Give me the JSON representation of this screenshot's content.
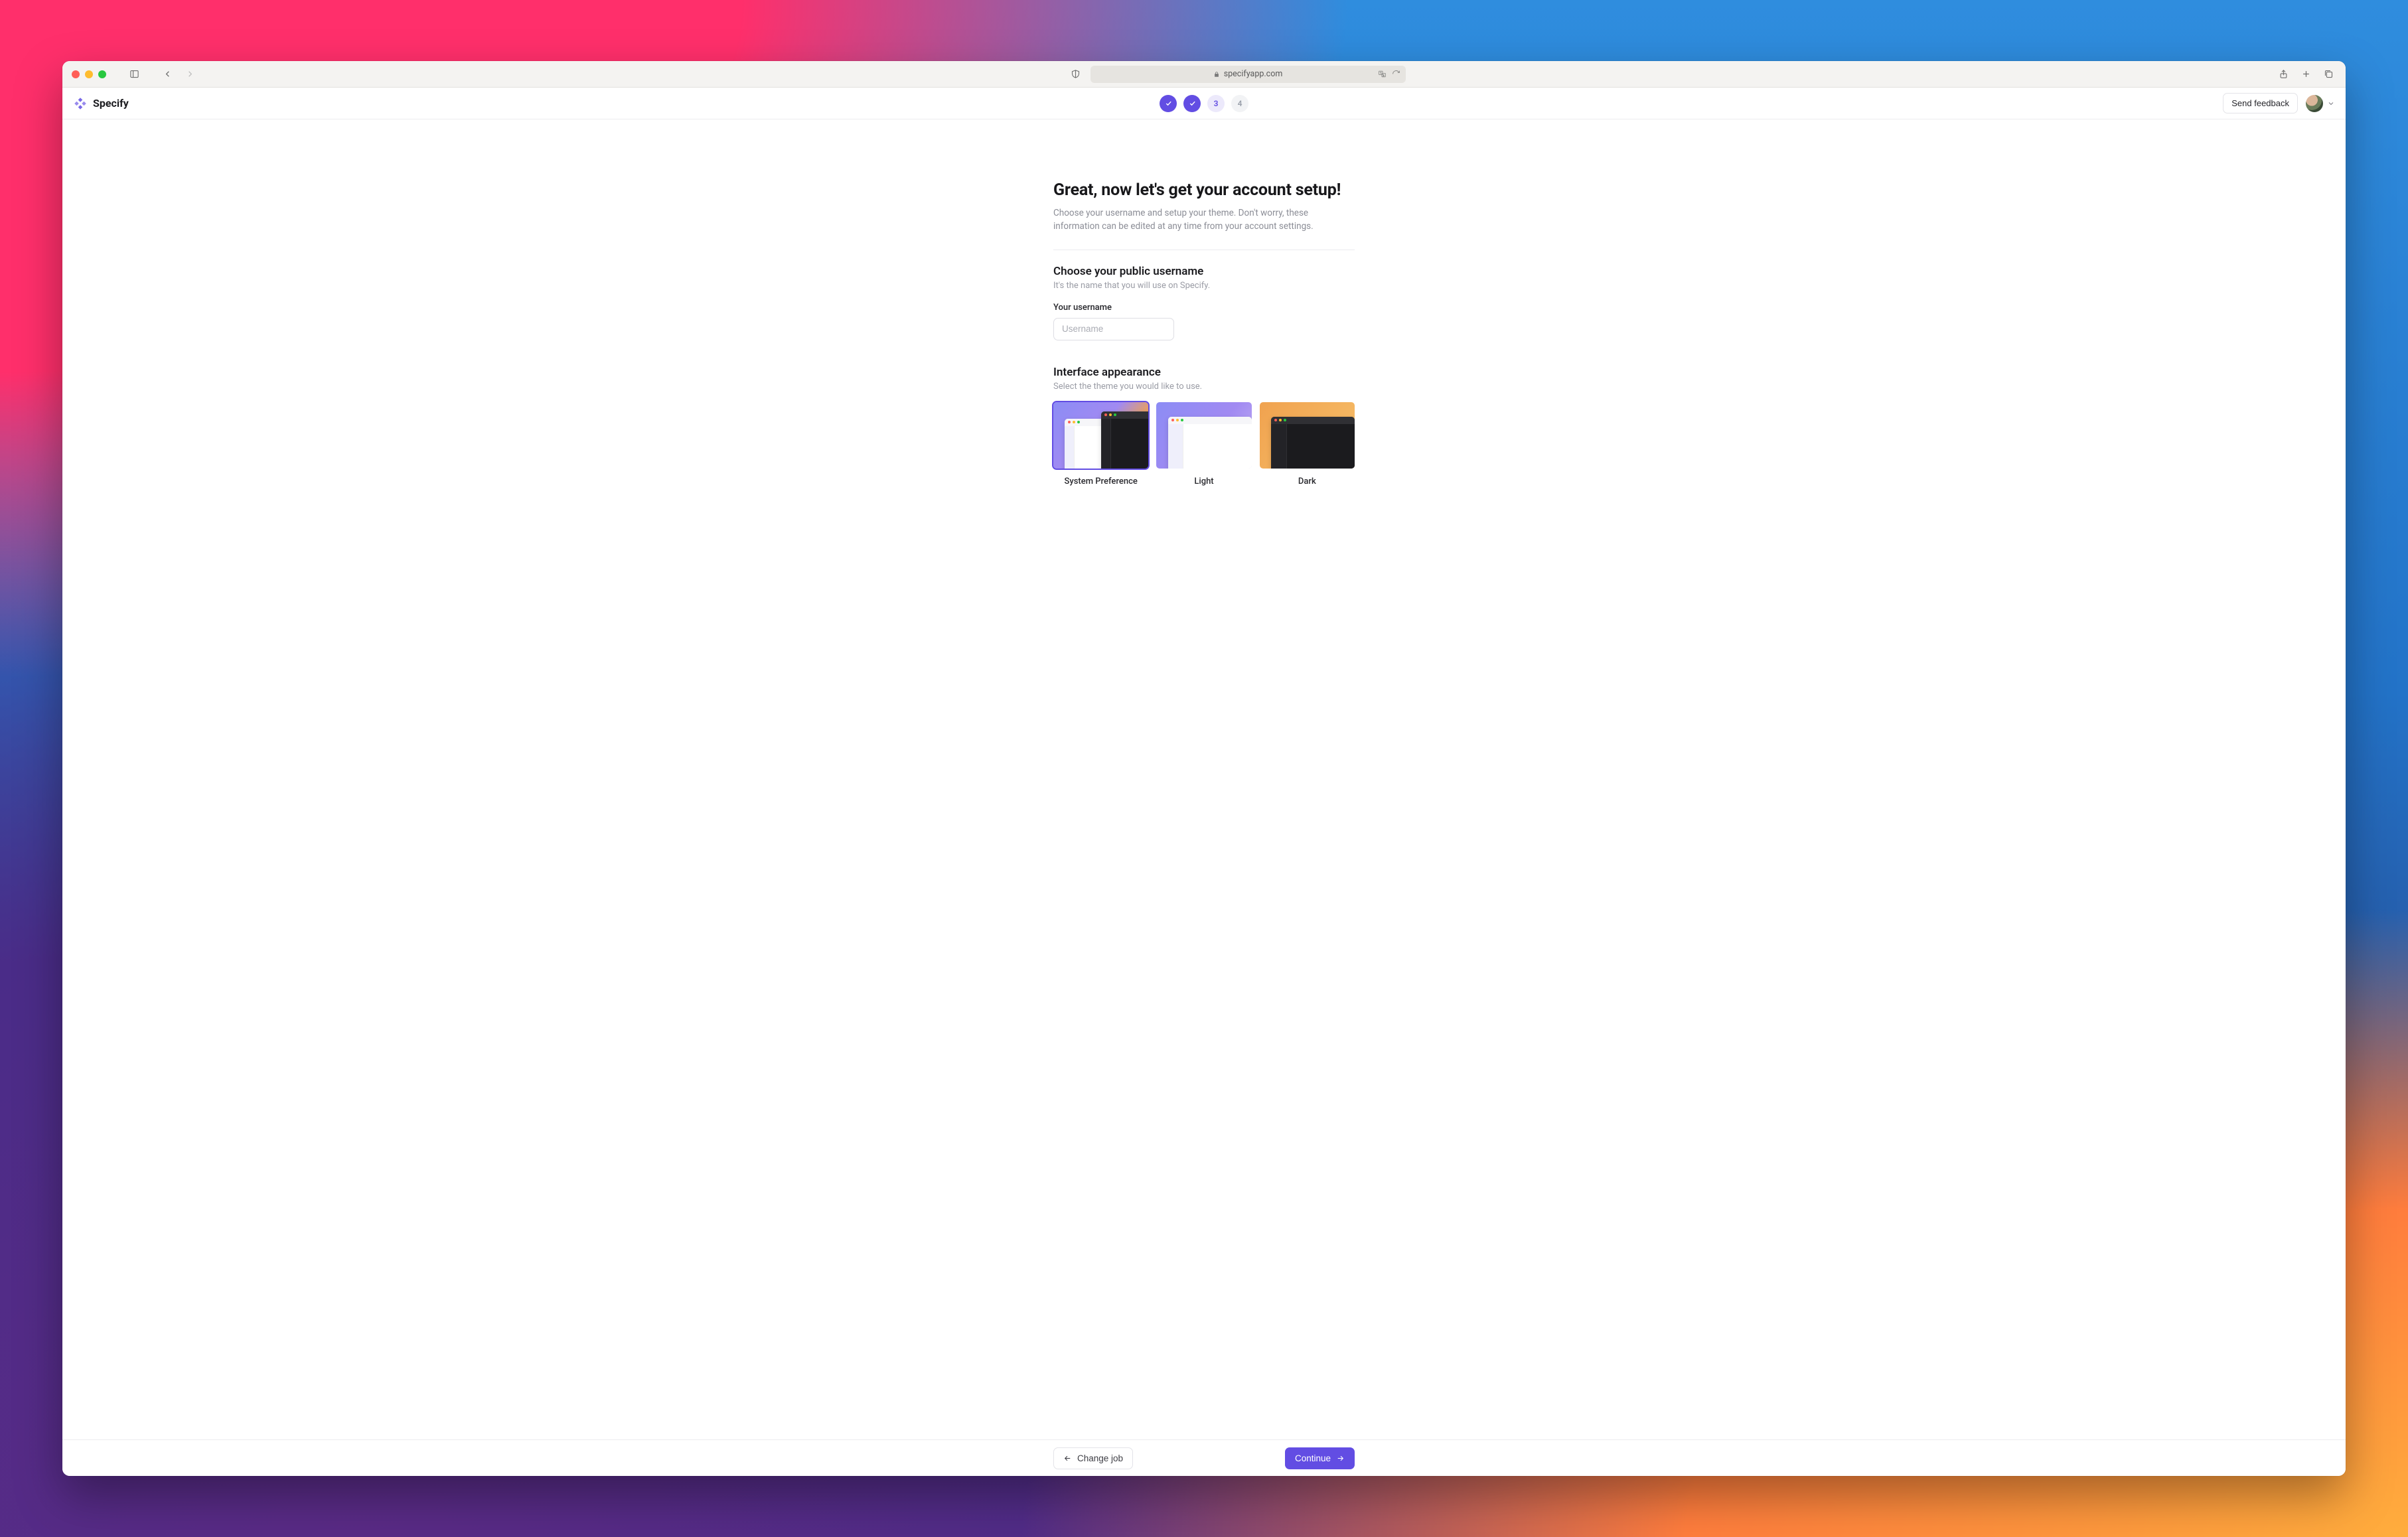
{
  "browser": {
    "url_display": "specifyapp.com"
  },
  "header": {
    "brand": "Specify",
    "feedback_label": "Send feedback",
    "steps": [
      "done",
      "done",
      "3",
      "4"
    ],
    "step3_label": "3",
    "step4_label": "4"
  },
  "setup": {
    "title": "Great, now let's get your account setup!",
    "subtitle": "Choose your username and setup your theme. Don't worry, these information can be edited at any time from your account settings.",
    "username_section": {
      "heading": "Choose your public username",
      "subheading": "It's the name that you will use on Specify.",
      "field_label": "Your username",
      "placeholder": "Username"
    },
    "appearance_section": {
      "heading": "Interface appearance",
      "subheading": "Select the theme you would like to use.",
      "options": {
        "system": "System Preference",
        "light": "Light",
        "dark": "Dark"
      }
    }
  },
  "footer": {
    "back_label": "Change job",
    "next_label": "Continue"
  },
  "colors": {
    "accent": "#624de3"
  }
}
